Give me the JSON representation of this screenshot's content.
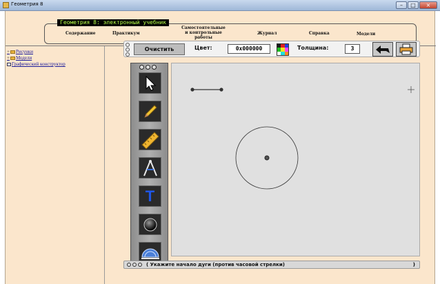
{
  "window": {
    "title": "Геометрия 8",
    "minimize": "–",
    "maximize": "□",
    "close": "×"
  },
  "header": {
    "title": "Геометрия 8: электронный учебник"
  },
  "menu": {
    "contents": "Содержание",
    "practicum": "Практикум",
    "independent_1": "Самостоятельные",
    "independent_2": "и контрольные",
    "independent_3": "работы",
    "journal": "Журнал",
    "help": "Справка",
    "models": "Модели"
  },
  "sidebar": {
    "items": [
      {
        "label": "Рисунки",
        "expander": "+",
        "icon": "folder-icon"
      },
      {
        "label": "Модели",
        "expander": "+",
        "icon": "folder-icon"
      },
      {
        "label": "Графический конструктор",
        "icon": "document-icon"
      }
    ]
  },
  "toolbar": {
    "clear_label": "Очистить",
    "color_label": "Цвет:",
    "color_value": "0x000000",
    "thickness_label": "Толщина:",
    "thickness_value": "3"
  },
  "tools": [
    "pointer-icon",
    "pencil-icon",
    "ruler-icon",
    "compass-icon",
    "text-icon",
    "point-icon",
    "protractor-icon"
  ],
  "tool_text_glyph": "T",
  "status": {
    "message": "( Укажите начало дуги (против часовой стрелки)",
    "end": ")"
  },
  "colors": {
    "frame": "#fbe6cc",
    "header_bg": "#000000",
    "header_text": "#b8ff4a",
    "link": "#1a1a9a",
    "canvas": "#e0e0e0",
    "text_tool": "#1f56e8"
  }
}
